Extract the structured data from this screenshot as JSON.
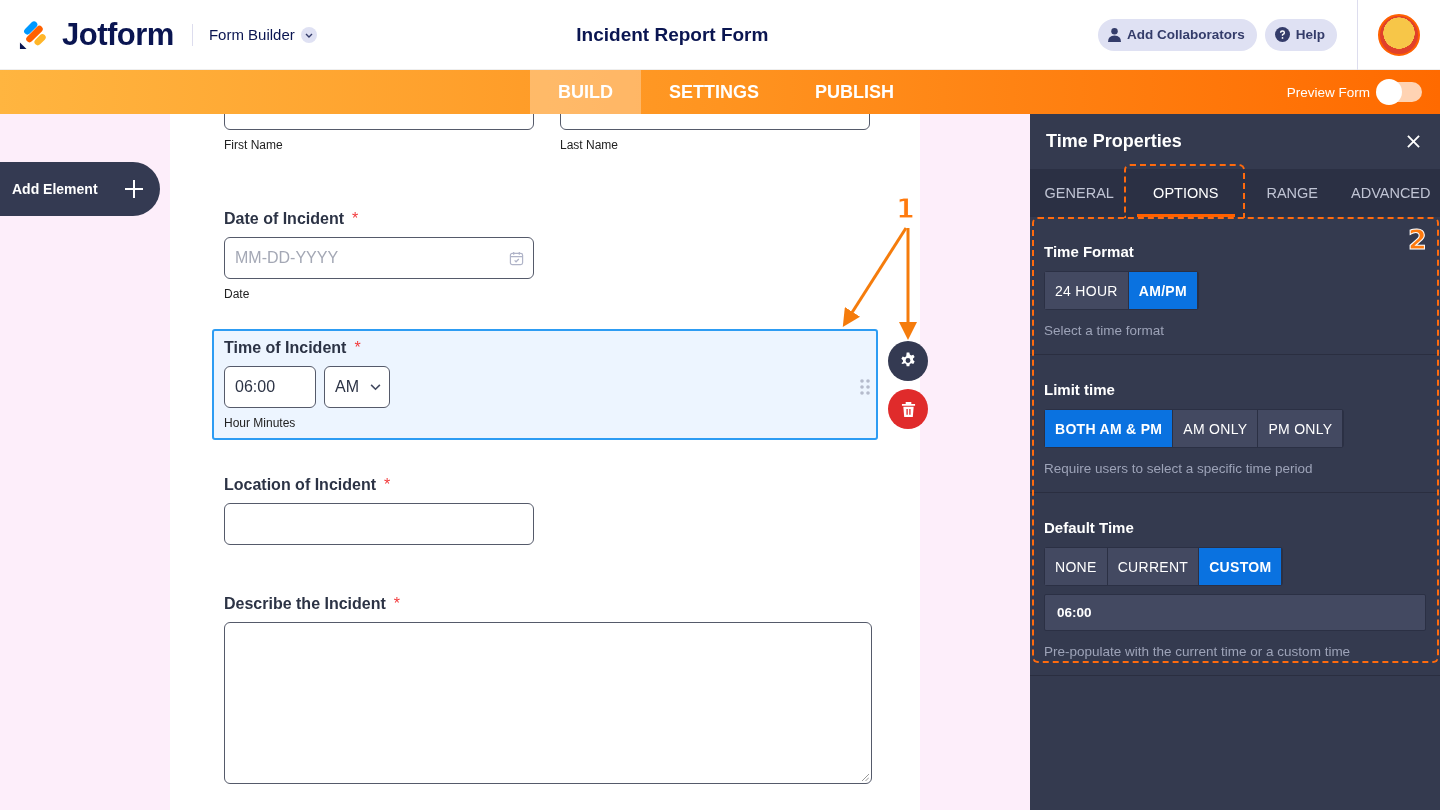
{
  "header": {
    "brand": "Jotform",
    "app_menu": "Form Builder",
    "title": "Incident Report Form",
    "buttons": [
      {
        "kind": "collaborators",
        "label": "Add Collaborators"
      },
      {
        "kind": "help",
        "label": "Help"
      }
    ]
  },
  "nav": {
    "tabs": [
      {
        "label": "BUILD",
        "selected": true
      },
      {
        "label": "SETTINGS",
        "selected": false
      },
      {
        "label": "PUBLISH",
        "selected": false
      }
    ],
    "preview": {
      "label": "Preview Form",
      "on": false
    }
  },
  "add_element": {
    "label": "Add Element"
  },
  "form": {
    "fields": [
      {
        "kind": "name",
        "subfields": [
          {
            "sublabel": "First Name"
          },
          {
            "sublabel": "Last Name"
          }
        ],
        "selected": false
      },
      {
        "kind": "date",
        "label": "Date of Incident",
        "required_mark": "*",
        "placeholder": "MM-DD-YYYY",
        "sublabel": "Date",
        "selected": false
      },
      {
        "kind": "time",
        "label": "Time of Incident",
        "required_mark": "*",
        "value": "06:00",
        "ampm": "AM",
        "sublabel": "Hour Minutes",
        "selected": true
      },
      {
        "kind": "input",
        "label": "Location of Incident",
        "required_mark": "*",
        "selected": false
      },
      {
        "kind": "textarea",
        "label": "Describe the Incident",
        "required_mark": "*",
        "selected": false
      }
    ]
  },
  "properties": {
    "title": "Time Properties",
    "tabs": [
      {
        "label": "GENERAL",
        "selected": false
      },
      {
        "label": "OPTIONS",
        "selected": true
      },
      {
        "label": "RANGE",
        "selected": false
      },
      {
        "label": "ADVANCED",
        "selected": false
      }
    ],
    "sections": [
      {
        "title": "Time Format",
        "options": [
          {
            "label": "24 HOUR",
            "selected": false
          },
          {
            "label": "AM/PM",
            "selected": true
          }
        ],
        "hint": "Select a time format"
      },
      {
        "title": "Limit time",
        "options": [
          {
            "label": "BOTH AM & PM",
            "selected": true
          },
          {
            "label": "AM ONLY",
            "selected": false
          },
          {
            "label": "PM ONLY",
            "selected": false
          }
        ],
        "hint": "Require users to select a specific time period"
      },
      {
        "title": "Default Time",
        "options": [
          {
            "label": "NONE",
            "selected": false
          },
          {
            "label": "CURRENT",
            "selected": false
          },
          {
            "label": "CUSTOM",
            "selected": true
          }
        ],
        "value": "06:00",
        "hint": "Pre-populate with the current time or a custom time"
      }
    ]
  },
  "annotations": [
    {
      "label": "1"
    },
    {
      "label": "2"
    }
  ]
}
